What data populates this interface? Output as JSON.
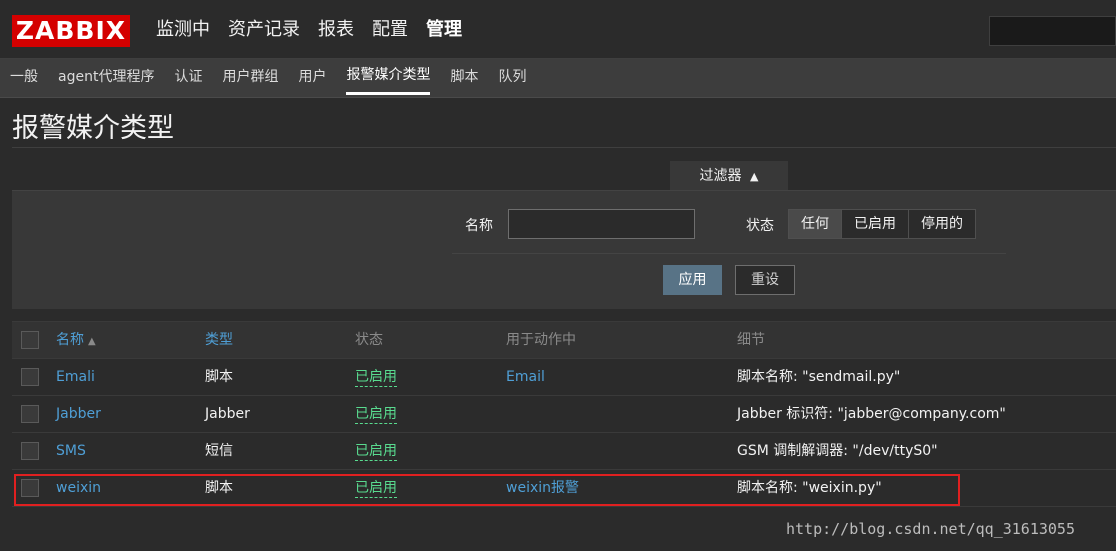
{
  "header": {
    "logo": "ZABBIX",
    "nav": [
      "监测中",
      "资产记录",
      "报表",
      "配置",
      "管理"
    ],
    "active_nav": "管理"
  },
  "subnav": {
    "items": [
      "一般",
      "agent代理程序",
      "认证",
      "用户群组",
      "用户",
      "报警媒介类型",
      "脚本",
      "队列"
    ],
    "active": "报警媒介类型"
  },
  "page": {
    "title": "报警媒介类型"
  },
  "filter": {
    "tab_label": "过滤器",
    "tab_icon": "triangle-up-icon",
    "name_label": "名称",
    "name_value": "",
    "status_label": "状态",
    "status_options": [
      "任何",
      "已启用",
      "停用的"
    ],
    "status_selected": "任何",
    "apply_label": "应用",
    "reset_label": "重设"
  },
  "table": {
    "columns": [
      "名称",
      "类型",
      "状态",
      "用于动作中",
      "细节"
    ],
    "sorted_by": "名称",
    "rows": [
      {
        "name": "Emali",
        "type": "脚本",
        "status": "已启用",
        "used_in": "Email",
        "details": "脚本名称: \"sendmail.py\""
      },
      {
        "name": "Jabber",
        "type": "Jabber",
        "status": "已启用",
        "used_in": "",
        "details": "Jabber 标识符: \"jabber@company.com\""
      },
      {
        "name": "SMS",
        "type": "短信",
        "status": "已启用",
        "used_in": "",
        "details": "GSM 调制解调器: \"/dev/ttyS0\""
      },
      {
        "name": "weixin",
        "type": "脚本",
        "status": "已启用",
        "used_in": "weixin报警",
        "details": "脚本名称: \"weixin.py\""
      }
    ]
  },
  "colors": {
    "logo_bg": "#d40000",
    "link": "#4f9fd6",
    "enabled": "#59db8f",
    "highlight": "#e02020",
    "apply_bg": "#587386"
  },
  "watermark": "http://blog.csdn.net/qq_31613055"
}
